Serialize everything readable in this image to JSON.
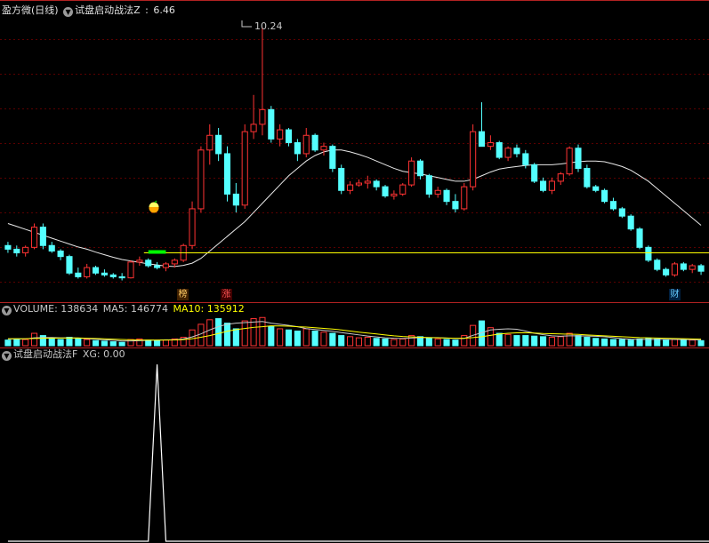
{
  "main_panel": {
    "title": "盈方微(日线)",
    "indicator_name": "试盘启动战法Z",
    "indicator_value": "6.46",
    "peak_label": "10.24",
    "badges": [
      {
        "text": "榜",
        "color": "#ffcc66",
        "bg": "#402000"
      },
      {
        "text": "涨",
        "color": "#ff5555",
        "bg": "#400000"
      },
      {
        "text": "财",
        "color": "#66ccff",
        "bg": "#002040"
      }
    ],
    "colors": {
      "up": "#ff3333",
      "down": "#54ffff",
      "ma": "#e8e8e8",
      "level": "#ffff00",
      "signal": "#00ff00"
    }
  },
  "volume_panel": {
    "label": "VOLUME: 138634",
    "ma5_label": "MA5: 146774",
    "ma10_label": "MA10: 135912",
    "colors": {
      "label": "#c8c8c8",
      "ma5": "#c8c8c8",
      "ma10": "#ffff00"
    }
  },
  "signal_panel": {
    "name": "试盘启动战法F",
    "xg_label": "XG: 0.00"
  },
  "chart_data": {
    "type": "candlestick",
    "candles": [
      [
        4.3,
        4.4,
        4.1,
        4.2
      ],
      [
        4.2,
        4.3,
        4.0,
        4.1
      ],
      [
        4.1,
        4.3,
        4.0,
        4.25
      ],
      [
        4.25,
        4.9,
        4.2,
        4.8
      ],
      [
        4.8,
        4.9,
        4.2,
        4.3
      ],
      [
        4.3,
        4.4,
        4.1,
        4.15
      ],
      [
        4.15,
        4.2,
        3.9,
        4.0
      ],
      [
        4.0,
        4.05,
        3.5,
        3.55
      ],
      [
        3.55,
        3.7,
        3.4,
        3.45
      ],
      [
        3.45,
        3.8,
        3.4,
        3.7
      ],
      [
        3.7,
        3.75,
        3.5,
        3.55
      ],
      [
        3.55,
        3.65,
        3.45,
        3.5
      ],
      [
        3.5,
        3.55,
        3.4,
        3.45
      ],
      [
        3.45,
        3.55,
        3.35,
        3.42
      ],
      [
        3.42,
        3.9,
        3.4,
        3.85
      ],
      [
        3.85,
        4.0,
        3.75,
        3.9
      ],
      [
        3.9,
        3.95,
        3.7,
        3.75
      ],
      [
        3.75,
        3.85,
        3.65,
        3.7
      ],
      [
        3.7,
        3.85,
        3.6,
        3.8
      ],
      [
        3.8,
        3.95,
        3.7,
        3.9
      ],
      [
        3.9,
        4.35,
        3.85,
        4.3
      ],
      [
        4.3,
        5.5,
        4.2,
        5.3
      ],
      [
        5.3,
        7.0,
        5.2,
        6.9
      ],
      [
        6.9,
        7.6,
        6.5,
        7.3
      ],
      [
        7.3,
        7.5,
        6.6,
        6.8
      ],
      [
        6.8,
        7.0,
        5.5,
        5.7
      ],
      [
        5.7,
        6.0,
        5.2,
        5.4
      ],
      [
        5.4,
        7.6,
        5.3,
        7.4
      ],
      [
        7.4,
        8.4,
        7.2,
        7.6
      ],
      [
        7.6,
        10.24,
        7.3,
        8.0
      ],
      [
        8.0,
        8.1,
        7.1,
        7.2
      ],
      [
        7.2,
        7.6,
        7.0,
        7.45
      ],
      [
        7.45,
        7.5,
        7.0,
        7.1
      ],
      [
        7.1,
        7.2,
        6.6,
        6.8
      ],
      [
        6.8,
        7.5,
        6.7,
        7.3
      ],
      [
        7.3,
        7.35,
        6.85,
        6.9
      ],
      [
        6.9,
        7.1,
        6.75,
        7.0
      ],
      [
        7.0,
        7.05,
        6.3,
        6.4
      ],
      [
        6.4,
        6.5,
        5.7,
        5.8
      ],
      [
        5.8,
        6.05,
        5.7,
        5.95
      ],
      [
        5.95,
        6.1,
        5.9,
        6.0
      ],
      [
        6.0,
        6.2,
        5.85,
        6.05
      ],
      [
        6.05,
        6.1,
        5.8,
        5.9
      ],
      [
        5.9,
        5.95,
        5.6,
        5.65
      ],
      [
        5.65,
        5.8,
        5.55,
        5.7
      ],
      [
        5.7,
        6.0,
        5.65,
        5.95
      ],
      [
        5.95,
        6.7,
        5.9,
        6.6
      ],
      [
        6.6,
        6.65,
        6.1,
        6.2
      ],
      [
        6.2,
        6.25,
        5.6,
        5.7
      ],
      [
        5.7,
        5.9,
        5.6,
        5.8
      ],
      [
        5.8,
        5.85,
        5.4,
        5.5
      ],
      [
        5.5,
        5.7,
        5.2,
        5.3
      ],
      [
        5.3,
        6.0,
        5.25,
        5.9
      ],
      [
        5.9,
        7.6,
        5.8,
        7.4
      ],
      [
        7.4,
        8.2,
        7.2,
        7.0
      ],
      [
        7.0,
        7.3,
        6.9,
        7.1
      ],
      [
        7.1,
        7.15,
        6.65,
        6.7
      ],
      [
        6.7,
        7.0,
        6.6,
        6.95
      ],
      [
        6.95,
        7.05,
        6.7,
        6.8
      ],
      [
        6.8,
        6.9,
        6.4,
        6.5
      ],
      [
        6.5,
        6.55,
        6.0,
        6.05
      ],
      [
        6.05,
        6.15,
        5.75,
        5.8
      ],
      [
        5.8,
        6.15,
        5.7,
        6.05
      ],
      [
        6.05,
        6.3,
        5.95,
        6.25
      ],
      [
        6.25,
        7.0,
        6.2,
        6.95
      ],
      [
        6.95,
        7.05,
        6.3,
        6.4
      ],
      [
        6.4,
        6.5,
        5.85,
        5.9
      ],
      [
        5.9,
        5.95,
        5.75,
        5.8
      ],
      [
        5.8,
        5.85,
        5.45,
        5.5
      ],
      [
        5.5,
        5.6,
        5.25,
        5.3
      ],
      [
        5.3,
        5.35,
        5.05,
        5.1
      ],
      [
        5.1,
        5.15,
        4.7,
        4.75
      ],
      [
        4.75,
        4.8,
        4.2,
        4.25
      ],
      [
        4.25,
        4.3,
        3.85,
        3.9
      ],
      [
        3.9,
        3.95,
        3.6,
        3.65
      ],
      [
        3.65,
        3.7,
        3.45,
        3.5
      ],
      [
        3.5,
        3.85,
        3.45,
        3.8
      ],
      [
        3.8,
        3.85,
        3.6,
        3.65
      ],
      [
        3.65,
        3.8,
        3.55,
        3.75
      ],
      [
        3.75,
        3.8,
        3.5,
        3.6
      ]
    ],
    "ma_line": [
      4.9,
      4.82,
      4.74,
      4.66,
      4.58,
      4.5,
      4.42,
      4.34,
      4.26,
      4.2,
      4.12,
      4.05,
      3.98,
      3.92,
      3.88,
      3.84,
      3.8,
      3.77,
      3.74,
      3.73,
      3.76,
      3.82,
      3.95,
      4.15,
      4.35,
      4.55,
      4.75,
      4.95,
      5.2,
      5.45,
      5.7,
      5.95,
      6.2,
      6.4,
      6.6,
      6.75,
      6.85,
      6.9,
      6.9,
      6.85,
      6.78,
      6.7,
      6.6,
      6.5,
      6.4,
      6.32,
      6.28,
      6.25,
      6.2,
      6.15,
      6.1,
      6.05,
      6.05,
      6.1,
      6.2,
      6.3,
      6.38,
      6.42,
      6.45,
      6.48,
      6.5,
      6.5,
      6.5,
      6.52,
      6.55,
      6.58,
      6.6,
      6.6,
      6.58,
      6.52,
      6.45,
      6.35,
      6.2,
      6.05,
      5.85,
      5.65,
      5.45,
      5.25,
      5.05,
      4.85
    ],
    "level": 4.1,
    "signal_range": [
      16,
      20
    ],
    "volume": [
      50,
      60,
      55,
      110,
      90,
      60,
      55,
      75,
      60,
      55,
      45,
      40,
      35,
      30,
      55,
      60,
      50,
      45,
      50,
      60,
      75,
      140,
      190,
      230,
      240,
      200,
      150,
      220,
      240,
      250,
      170,
      150,
      140,
      130,
      150,
      130,
      120,
      110,
      90,
      80,
      70,
      75,
      65,
      60,
      55,
      60,
      90,
      80,
      70,
      60,
      55,
      50,
      90,
      180,
      220,
      160,
      110,
      100,
      90,
      90,
      85,
      80,
      75,
      80,
      110,
      90,
      75,
      65,
      60,
      55,
      55,
      50,
      60,
      65,
      60,
      50,
      55,
      50,
      50,
      45
    ],
    "vol_ma5": [
      60,
      60,
      60,
      70,
      72,
      73,
      70,
      70,
      68,
      62,
      58,
      52,
      48,
      42,
      42,
      44,
      48,
      50,
      52,
      52,
      60,
      78,
      105,
      140,
      170,
      190,
      200,
      205,
      210,
      215,
      200,
      190,
      180,
      168,
      152,
      144,
      136,
      128,
      116,
      106,
      96,
      86,
      78,
      70,
      66,
      64,
      68,
      72,
      72,
      72,
      68,
      64,
      64,
      92,
      115,
      140,
      146,
      150,
      146,
      130,
      110,
      98,
      88,
      84,
      88,
      88,
      86,
      84,
      80,
      72,
      62,
      58,
      56,
      56,
      56,
      56,
      56,
      55,
      53,
      52
    ],
    "vol_ma10": [
      62,
      62,
      62,
      64,
      66,
      67,
      68,
      68,
      69,
      66,
      64,
      61,
      58,
      55,
      52,
      50,
      50,
      49,
      50,
      51,
      54,
      62,
      75,
      90,
      108,
      128,
      143,
      153,
      163,
      168,
      176,
      175,
      173,
      168,
      165,
      160,
      154,
      148,
      140,
      130,
      120,
      112,
      104,
      96,
      88,
      82,
      78,
      75,
      72,
      70,
      68,
      66,
      66,
      72,
      80,
      92,
      103,
      110,
      114,
      115,
      112,
      108,
      106,
      104,
      102,
      100,
      96,
      92,
      88,
      84,
      80,
      76,
      72,
      70,
      68,
      66,
      64,
      62,
      60,
      58
    ],
    "signal": [
      0,
      0,
      0,
      0,
      0,
      0,
      0,
      0,
      0,
      0,
      0,
      0,
      0,
      0,
      0,
      0,
      0,
      1,
      0,
      0
    ]
  }
}
